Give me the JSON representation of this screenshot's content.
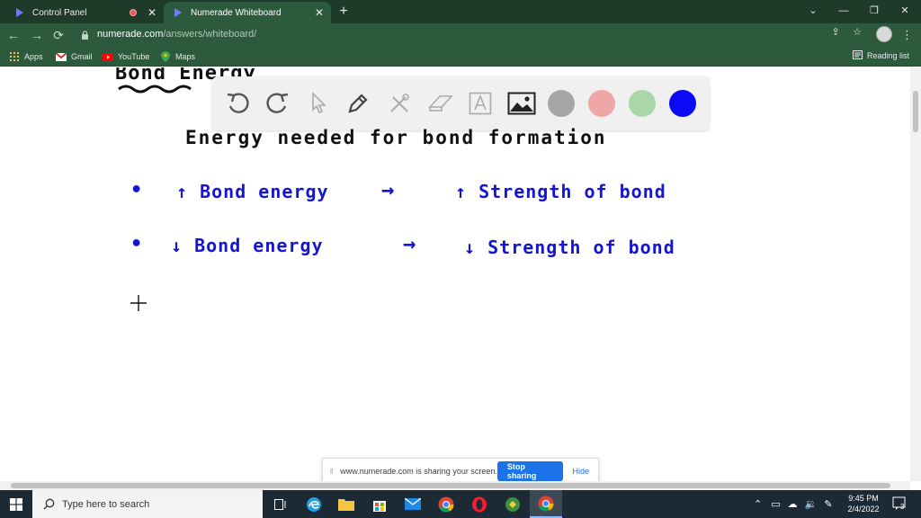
{
  "browser": {
    "tabs": [
      {
        "title": "Control Panel",
        "active": false
      },
      {
        "title": "Numerade Whiteboard",
        "active": true
      }
    ],
    "window_buttons": {
      "dropdown": "⌄",
      "minimize": "—",
      "restore": "❐",
      "close": "✕"
    },
    "new_tab": "+",
    "nav": {
      "back": "←",
      "forward": "→",
      "reload": "⟳"
    },
    "url_domain": "numerade.com",
    "url_path": "/answers/whiteboard/",
    "bookmarks": [
      {
        "label": "Apps"
      },
      {
        "label": "Gmail"
      },
      {
        "label": "YouTube"
      },
      {
        "label": "Maps"
      }
    ],
    "reading_list": "Reading list"
  },
  "whiteboard": {
    "tools": [
      {
        "name": "undo"
      },
      {
        "name": "redo"
      },
      {
        "name": "select"
      },
      {
        "name": "pen"
      },
      {
        "name": "tools"
      },
      {
        "name": "eraser"
      },
      {
        "name": "text"
      },
      {
        "name": "image"
      }
    ],
    "colors": [
      "#a6a6a6",
      "#f0a6a6",
      "#a9d7a9",
      "#0a0af5"
    ],
    "ink": {
      "heading_partial": "Bond Energy",
      "line1": "Energy needed for bond formation",
      "bullet1_left": "↑ Bond energy",
      "bullet1_arrow": "→",
      "bullet1_right": "↑ Strength of bond",
      "bullet2_left": "↓ Bond energy",
      "bullet2_arrow": "→",
      "bullet2_right": "↓ Strength of bond",
      "bullet_mark": "•"
    }
  },
  "share_banner": {
    "message": "www.numerade.com is sharing your screen.",
    "stop_label": "Stop sharing",
    "hide_label": "Hide"
  },
  "taskbar": {
    "search_placeholder": "Type here to search",
    "time": "9:45 PM",
    "date": "2/4/2022",
    "notification_count": "3"
  }
}
